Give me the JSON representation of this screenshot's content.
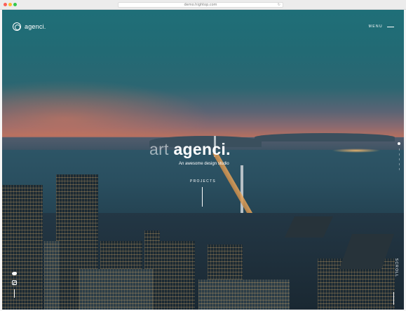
{
  "browser": {
    "url": "demo.hightop.com"
  },
  "header": {
    "brand": "agenci.",
    "menu_label": "MENU"
  },
  "hero": {
    "headline_word1": "art",
    "headline_word2": "agenci.",
    "tagline": "An awesome design studio",
    "cta_label": "PROJECTS"
  },
  "side": {
    "scroll_label": "SCROLL"
  },
  "icons": {
    "logo": "globe-icon",
    "social": [
      "twitter-icon",
      "instagram-icon"
    ],
    "reload": "reload-icon"
  },
  "colors": {
    "text": "#ffffff",
    "headline_muted": "rgba(255,255,255,0.55)"
  }
}
